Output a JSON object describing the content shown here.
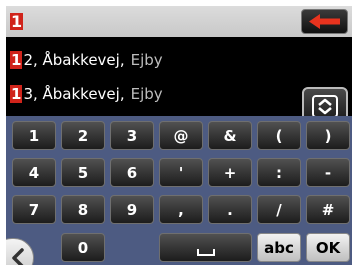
{
  "entry": {
    "value": "1"
  },
  "suggestions": [
    {
      "typed": "1",
      "street": "2, Åbakkevej,",
      "city": "Ejby"
    },
    {
      "typed": "1",
      "street": "3, Åbakkevej,",
      "city": "Ejby"
    }
  ],
  "keypad": {
    "row1": [
      "1",
      "2",
      "3",
      "@",
      "&",
      "(",
      ")"
    ],
    "row2": [
      "4",
      "5",
      "6",
      "'",
      "+",
      ":",
      "-"
    ],
    "row3": [
      "7",
      "8",
      "9",
      ",",
      ".",
      "/",
      "#"
    ],
    "row4": {
      "zero": "0",
      "space": "␣",
      "abc": "abc",
      "ok": "OK"
    }
  },
  "icons": {
    "backspace": "arrow-left-icon",
    "list_toggle": "up-down-chevron-icon",
    "back": "chevron-left-icon"
  },
  "colors": {
    "accent_red": "#d0241b",
    "keypad_bg": "#4d5b82"
  }
}
